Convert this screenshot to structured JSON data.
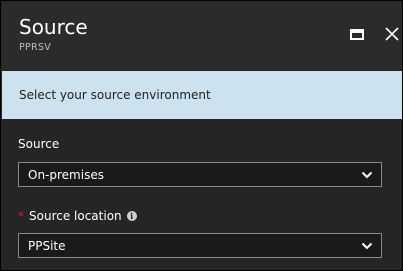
{
  "blade": {
    "title": "Source",
    "subtitle": "PPRSV"
  },
  "banner": {
    "text": "Select your source environment"
  },
  "fields": {
    "source": {
      "label": "Source",
      "value": "On-premises"
    },
    "source_location": {
      "label": "Source location",
      "required": true,
      "required_marker": "*",
      "info_glyph": "i",
      "value": "PPSite"
    }
  },
  "icons": {
    "maximize": "maximize-icon",
    "close": "close-icon",
    "chevron": "chevron-down-icon",
    "info": "info-icon"
  },
  "colors": {
    "background": "#252526",
    "header": "#2b2b2c",
    "banner": "#cde2ef",
    "required": "#e81123",
    "dropdown_bg": "#1a1a1a"
  }
}
